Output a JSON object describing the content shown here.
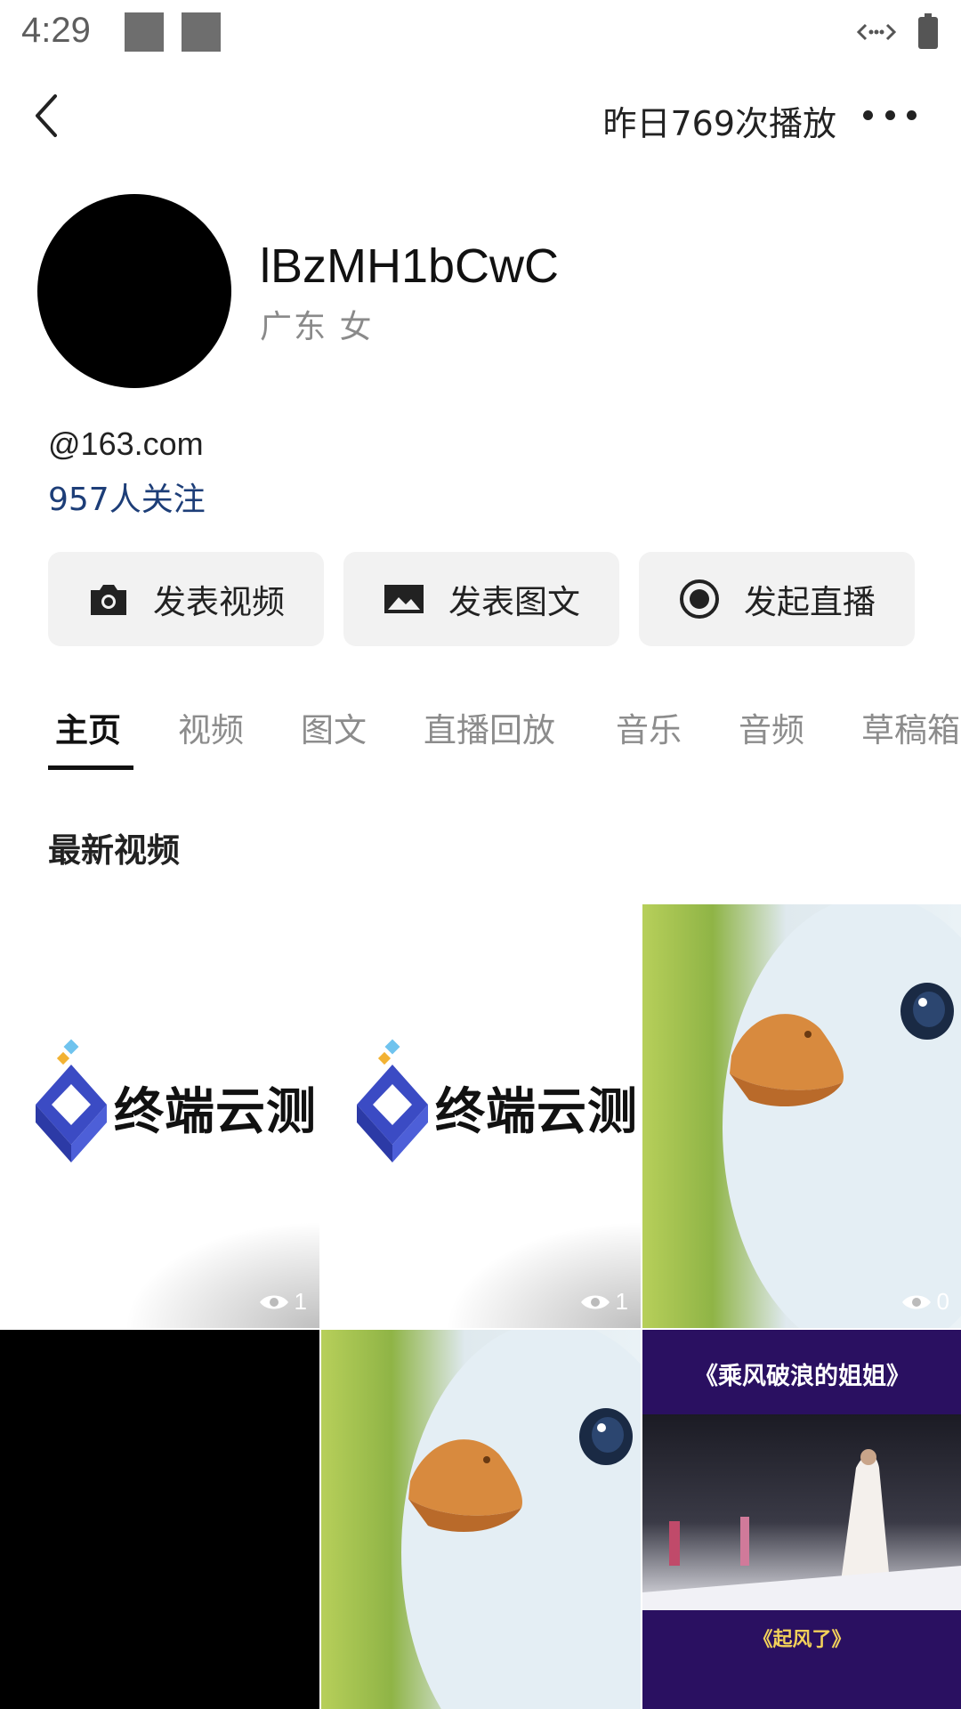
{
  "status_bar": {
    "time": "4:29"
  },
  "header": {
    "plays": "昨日769次播放"
  },
  "profile": {
    "username": "lBzMH1bCwC",
    "meta": "广东 女",
    "email": "@163.com",
    "follow": "957人关注"
  },
  "actions": [
    {
      "label": "发表视频",
      "icon": "camera-icon"
    },
    {
      "label": "发表图文",
      "icon": "image-icon"
    },
    {
      "label": "发起直播",
      "icon": "live-record-icon"
    }
  ],
  "tabs": [
    "主页",
    "视频",
    "图文",
    "直播回放",
    "音乐",
    "音频",
    "草稿箱"
  ],
  "active_tab": "主页",
  "section": {
    "title": "最新视频"
  },
  "videos": [
    {
      "views": "1",
      "logo_text": "终端云测"
    },
    {
      "views": "1",
      "logo_text": "终端云测"
    },
    {
      "views": "0"
    },
    {},
    {},
    {
      "top_text": "《乘风破浪的姐姐》",
      "bottom_text": "《起风了》"
    }
  ],
  "colors": {
    "link": "#1d3e78",
    "button_bg": "#f2f2f2",
    "logo_blue": "#3b4bc4"
  }
}
